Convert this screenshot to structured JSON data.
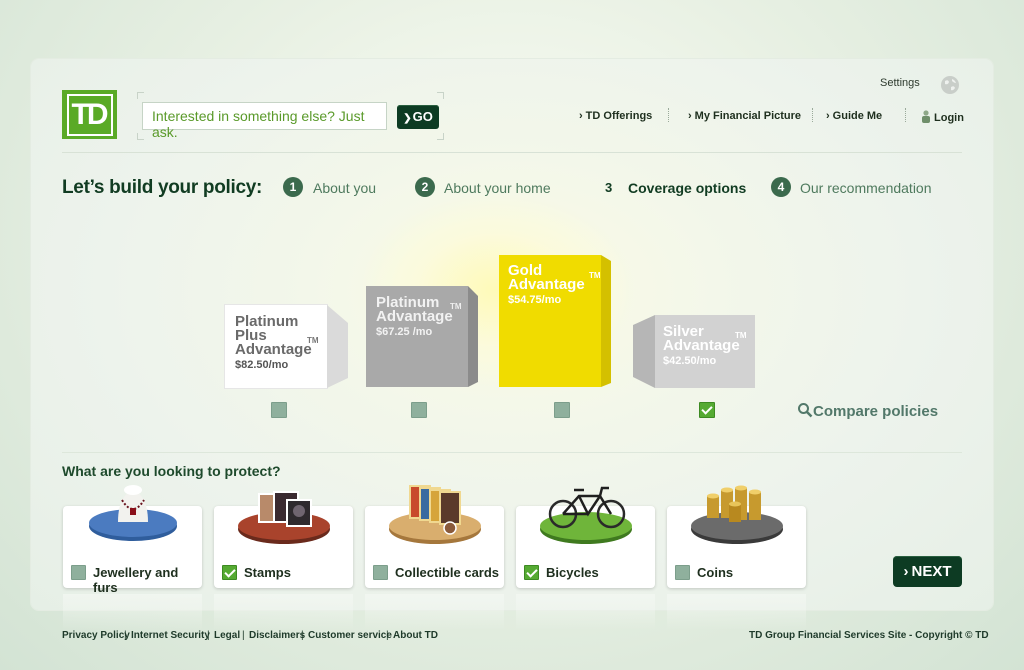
{
  "logo": {
    "text": "TD"
  },
  "search": {
    "placeholder": "Interested in something else? Just ask.",
    "go_label": "GO"
  },
  "header": {
    "settings_label": "Settings",
    "nav": [
      "TD Offerings",
      "My Financial Picture",
      "Guide Me",
      "Login"
    ]
  },
  "steps": {
    "title": "Let’s build your policy:",
    "items": [
      {
        "num": "1",
        "label": "About you"
      },
      {
        "num": "2",
        "label": "About your home"
      },
      {
        "num": "3",
        "label": "Coverage options"
      },
      {
        "num": "4",
        "label": "Our recommendation"
      }
    ],
    "active_step": 3
  },
  "policies": [
    {
      "name_lines": [
        "Platinum",
        "Plus",
        "Advantage"
      ],
      "tm": "TM",
      "price": "$82.50/mo",
      "color": "#ffffff",
      "checked": false
    },
    {
      "name_lines": [
        "Platinum",
        "Advantage"
      ],
      "tm": "TM",
      "price": "$67.25 /mo",
      "color": "#a9a9a9",
      "checked": false
    },
    {
      "name_lines": [
        "Gold",
        "Advantage"
      ],
      "tm": "TM",
      "price": "$54.75/mo",
      "color": "#f0dc00",
      "checked": false
    },
    {
      "name_lines": [
        "Silver",
        "Advantage"
      ],
      "tm": "TM",
      "price": "$42.50/mo",
      "color": "#d2d2d2",
      "checked": true
    }
  ],
  "compare_label": "Compare policies",
  "protect": {
    "heading": "What are you looking to protect?",
    "items": [
      {
        "label": "Jewellery and furs",
        "checked": false,
        "icon": "necklace-icon"
      },
      {
        "label": "Stamps",
        "checked": true,
        "icon": "stamps-icon"
      },
      {
        "label": "Collectible cards",
        "checked": false,
        "icon": "cards-icon"
      },
      {
        "label": "Bicycles",
        "checked": true,
        "icon": "bicycle-icon"
      },
      {
        "label": "Coins",
        "checked": false,
        "icon": "coins-icon"
      }
    ]
  },
  "next_label": "NEXT",
  "footer": {
    "links": [
      "Privacy Policy",
      "Internet Security",
      "Legal",
      "Disclaimers",
      "Customer service",
      "About TD"
    ],
    "copyright": "TD Group Financial Services Site - Copyright © TD"
  },
  "colors": {
    "brand_green": "#5aaa26",
    "dark_green": "#0d3b23",
    "gold": "#f0dc00",
    "check_green": "#55aa32"
  }
}
